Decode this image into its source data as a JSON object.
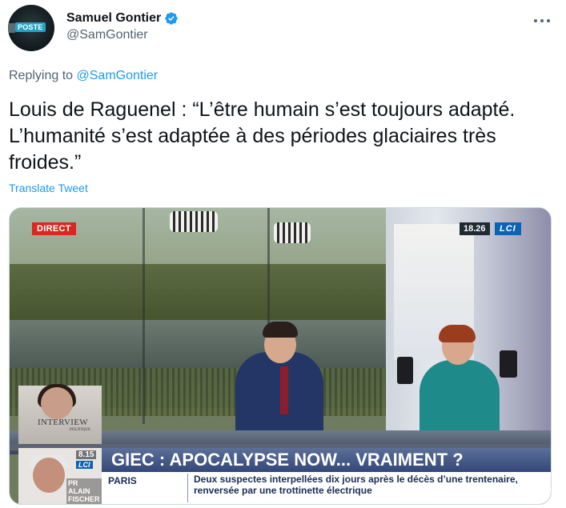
{
  "author": {
    "display_name": "Samuel Gontier",
    "handle": "@SamGontier",
    "verified": true,
    "avatar_tag": "POSTE"
  },
  "reply": {
    "prefix": "Replying to",
    "target": "@SamGontier"
  },
  "tweet": {
    "text": "Louis de Raguenel : “L’être humain s’est toujours adapté. L’humanité s’est adaptée à des périodes glaciaires très froides.”",
    "translate_label": "Translate Tweet"
  },
  "media": {
    "live_badge": "DIRECT",
    "time": "18.26",
    "channel": "LCI",
    "inset_label": "INTERVIEW",
    "inset_sublabel": "POLITIQUE",
    "side_time": "8.15",
    "side_channel": "LCI",
    "side_label": "PR ALAIN FISCHER",
    "banner_headline": "GIEC : APOCALYPSE NOW... VRAIMENT ?",
    "ticker_city": "PARIS",
    "ticker_news": "Deux suspectes interpellées dix jours après le décès d’une trentenaire, renversée par une trottinette électrique"
  },
  "colors": {
    "link": "#1d9bf0",
    "verified": "#1d9bf0",
    "text": "#0f1419",
    "secondary": "#536471"
  },
  "icons": [
    "verified-badge-icon",
    "more-options-icon"
  ]
}
